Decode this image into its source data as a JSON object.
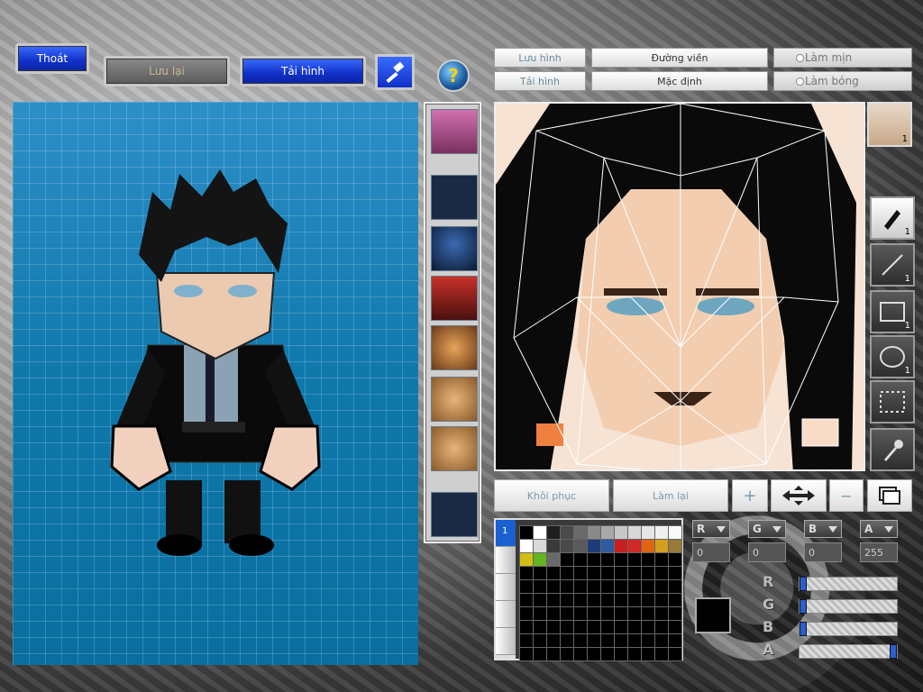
{
  "top_buttons": {
    "exit": "Thoát",
    "save": "Lưu lại",
    "load": "Tải hình"
  },
  "help_label": "?",
  "editor_tabs": {
    "save_image": "Lưu hình",
    "load_image": "Tải hình",
    "outline": "Đường viền",
    "default": "Mặc định",
    "smooth": "Làm mịn",
    "shade": "Làm bóng"
  },
  "actions": {
    "restore": "Khôi phục",
    "redo": "Làm lại"
  },
  "tools": [
    {
      "name": "pen-tool",
      "count": "1"
    },
    {
      "name": "line-tool",
      "count": "1"
    },
    {
      "name": "rect-tool",
      "count": "1"
    },
    {
      "name": "ellipse-tool",
      "count": "1"
    },
    {
      "name": "select-tool",
      "count": ""
    },
    {
      "name": "eyedropper-tool",
      "count": ""
    }
  ],
  "avatar_count": "1",
  "palette_tab_number": "1",
  "channels": {
    "r": "R",
    "g": "G",
    "b": "B",
    "a": "A"
  },
  "channel_values": {
    "r": "0",
    "g": "0",
    "b": "0",
    "a": "255"
  },
  "sliders": {
    "r": 0,
    "g": 0,
    "b": 0,
    "a": 1
  },
  "palette_colors": [
    "#000000",
    "#ffffff",
    "#1e1e1e",
    "#4a4a4a",
    "#6a6a6a",
    "#8a8a8a",
    "#a9a9a9",
    "#c8c8c8",
    "#d8d8d8",
    "#e6e6e6",
    "#f0f0f0",
    "#fafafa",
    "#ffffff",
    "#d9d9d9",
    "#3a3a3a",
    "#4a4a4a",
    "#5a5a5a",
    "#1e3c78",
    "#2e5aa0",
    "#c81e1e",
    "#d22828",
    "#e06414",
    "#d2a01e",
    "#9a7a3a",
    "#d2be14",
    "#64b41e",
    "#6a6a6a"
  ],
  "colors": {
    "accent": "#1030c8",
    "preview_bg": "#0a6ea0",
    "canvas_skin": "#f6e3d4"
  }
}
